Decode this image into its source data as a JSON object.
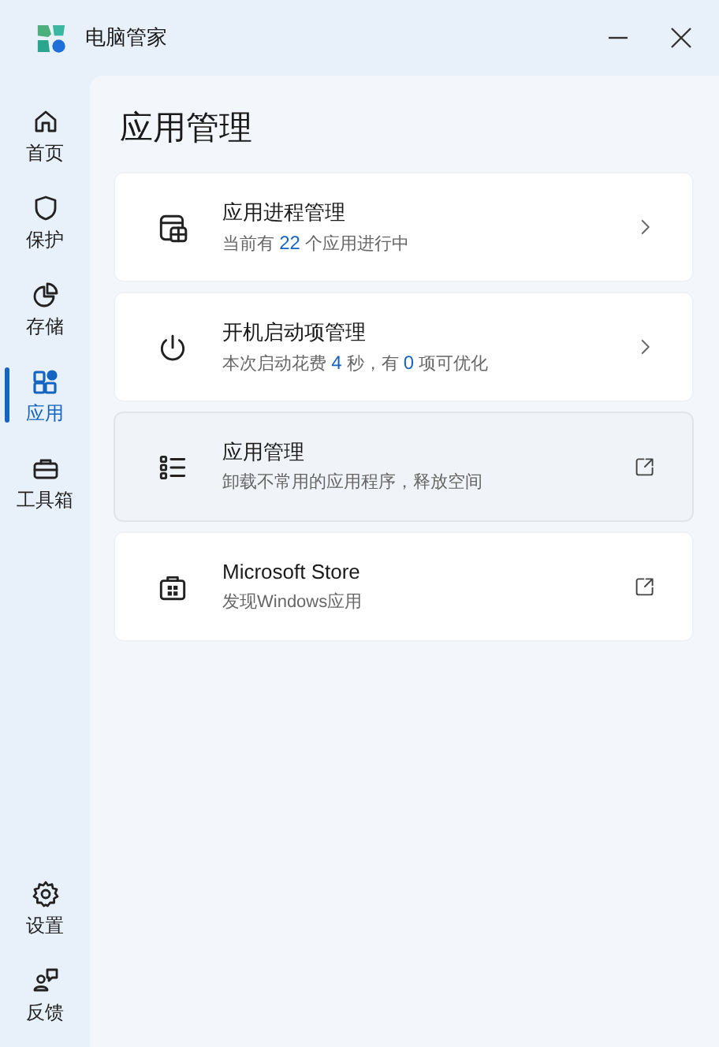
{
  "window": {
    "title": "电脑管家"
  },
  "sidebar": {
    "items": [
      {
        "kind": "home",
        "label": "首页",
        "selected": false
      },
      {
        "kind": "shield",
        "label": "保护",
        "selected": false
      },
      {
        "kind": "storage",
        "label": "存储",
        "selected": false
      },
      {
        "kind": "apps",
        "label": "应用",
        "selected": true
      },
      {
        "kind": "toolbox",
        "label": "工具箱",
        "selected": false
      }
    ],
    "bottom_items": [
      {
        "kind": "settings",
        "label": "设置"
      },
      {
        "kind": "feedback",
        "label": "反馈"
      }
    ]
  },
  "page": {
    "title": "应用管理",
    "cards": [
      {
        "kind": "process",
        "title": "应用进程管理",
        "subtitle": [
          {
            "text": "当前有 ",
            "highlight": false
          },
          {
            "text": "22",
            "highlight": true
          },
          {
            "text": " 个应用进行中",
            "highlight": false
          }
        ],
        "hovered": false
      },
      {
        "kind": "power",
        "title": "开机启动项管理",
        "subtitle": [
          {
            "text": "本次启动花费 ",
            "highlight": false
          },
          {
            "text": "4",
            "highlight": true
          },
          {
            "text": " 秒，有 ",
            "highlight": false
          },
          {
            "text": "0",
            "highlight": true
          },
          {
            "text": " 项可优化",
            "highlight": false
          }
        ],
        "hovered": false
      },
      {
        "kind": "list",
        "title": "应用管理",
        "subtitle": [
          {
            "text": "卸载不常用的应用程序，释放空间",
            "highlight": false
          }
        ],
        "hovered": true
      },
      {
        "kind": "store",
        "title": "Microsoft Store",
        "subtitle": [
          {
            "text": "发现Windows应用",
            "highlight": false
          }
        ],
        "hovered": false
      }
    ]
  }
}
